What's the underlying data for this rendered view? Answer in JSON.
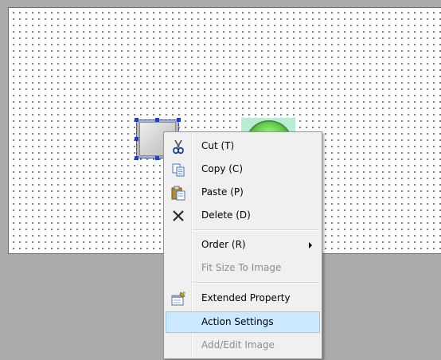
{
  "context_menu": {
    "items": [
      {
        "label": "Cut (T)",
        "icon": "scissors-icon",
        "enabled": true
      },
      {
        "label": "Copy (C)",
        "icon": "copy-icon",
        "enabled": true
      },
      {
        "label": "Paste (P)",
        "icon": "paste-icon",
        "enabled": true
      },
      {
        "label": "Delete (D)",
        "icon": "delete-x-icon",
        "enabled": true
      },
      {
        "label": "Order (R)",
        "icon": "",
        "enabled": true,
        "has_submenu": true
      },
      {
        "label": "Fit Size To Image",
        "icon": "",
        "enabled": false
      },
      {
        "label": "Extended Property",
        "icon": "extended-property-icon",
        "enabled": true
      },
      {
        "label": "Action Settings",
        "icon": "",
        "enabled": true,
        "highlighted": true
      },
      {
        "label": "Add/Edit Image",
        "icon": "",
        "enabled": false
      }
    ]
  },
  "colors": {
    "highlight_bg": "#cce8ff",
    "highlight_border": "#99c9ef",
    "selection_handles": "#1a3fd8",
    "workspace_bg": "#ababab",
    "lamp_bg": "#b9ecd4",
    "lamp_green": "#6ad44e"
  }
}
